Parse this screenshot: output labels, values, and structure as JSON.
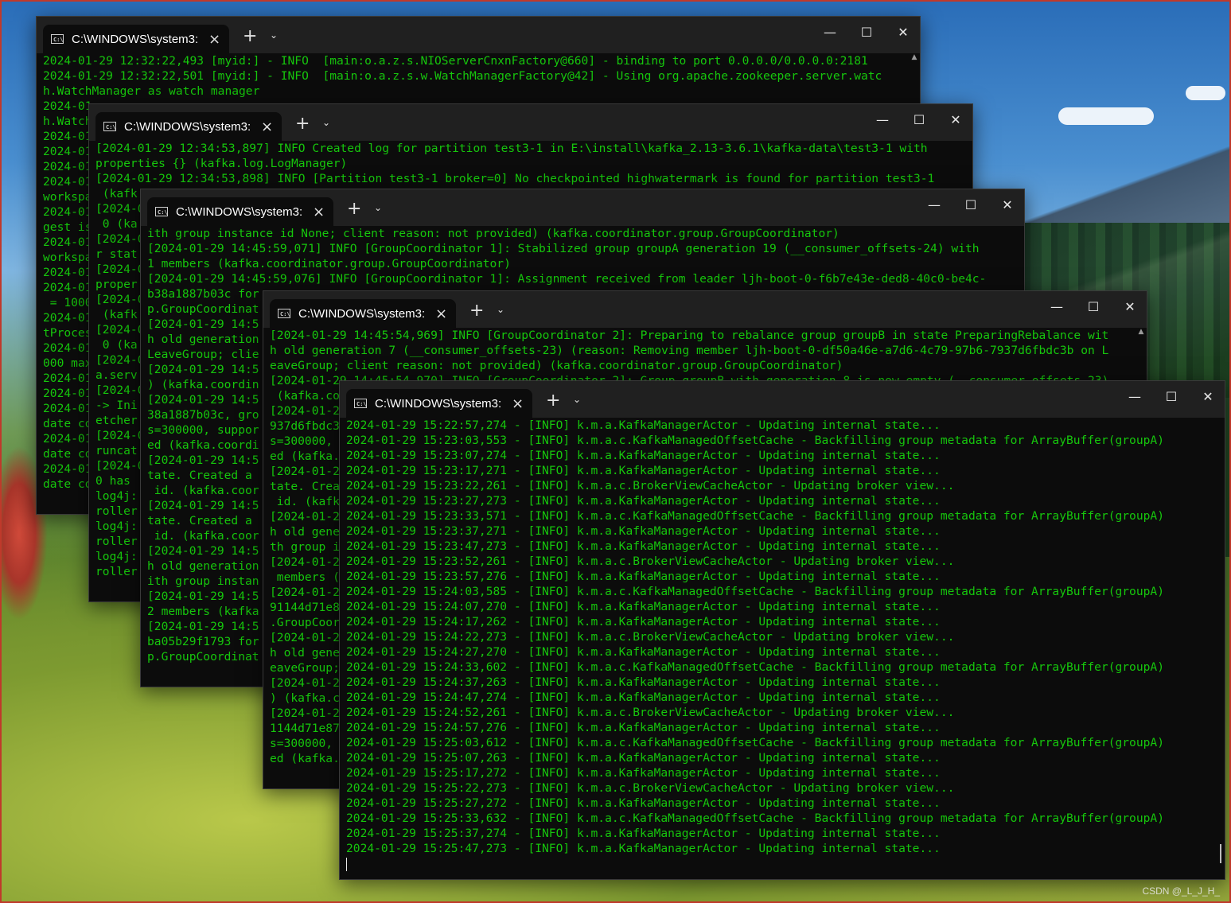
{
  "windows": [
    {
      "title": "C:\\WINDOWS\\system3:",
      "lines": [
        "2024-01-29 12:32:22,493 [myid:] - INFO  [main:o.a.z.s.NIOServerCnxnFactory@660] - binding to port 0.0.0.0/0.0.0.0:2181",
        "2024-01-29 12:32:22,501 [myid:] - INFO  [main:o.a.z.s.w.WatchManagerFactory@42] - Using org.apache.zookeeper.server.watc",
        "h.WatchManager as watch manager",
        "2024-01",
        "h.Watch",
        "2024-01",
        "2024-01",
        "2024-01",
        "2024-01",
        "workspa",
        "2024-01",
        "gest is",
        "2024-01",
        "workspa",
        "2024-01",
        "2024-01",
        " = 1000",
        "2024-01",
        "tProces",
        "2024-01",
        "000 max",
        "2024-01",
        "2024-01",
        "2024-01",
        "date co",
        "2024-01",
        "date co",
        "2024-01",
        "date co"
      ]
    },
    {
      "title": "C:\\WINDOWS\\system3:",
      "lines": [
        "[2024-01-29 12:34:53,897] INFO Created log for partition test3-1 in E:\\install\\kafka_2.13-3.6.1\\kafka-data\\test3-1 with",
        "properties {} (kafka.log.LogManager)",
        "[2024-01-29 12:34:53,898] INFO [Partition test3-1 broker=0] No checkpointed highwatermark is found for partition test3-1",
        " (kafk",
        "[2024-0",
        " 0 (ka",
        "[2024-0",
        "r stat",
        "[2024-0",
        "proper",
        "[2024-0",
        " (kafk",
        "[2024-0",
        " 0 (ka",
        "[2024-0",
        "a.serv",
        "[2024-0",
        "-> Ini",
        "etcher",
        "[2024-0",
        "runcat",
        "[2024-0",
        "0 has",
        "log4j:",
        "roller",
        "log4j:",
        "roller",
        "log4j:",
        "roller"
      ]
    },
    {
      "title": "C:\\WINDOWS\\system3:",
      "lines": [
        "ith group instance id None; client reason: not provided) (kafka.coordinator.group.GroupCoordinator)",
        "[2024-01-29 14:45:59,071] INFO [GroupCoordinator 1]: Stabilized group groupA generation 19 (__consumer_offsets-24) with",
        "1 members (kafka.coordinator.group.GroupCoordinator)",
        "[2024-01-29 14:45:59,076] INFO [GroupCoordinator 1]: Assignment received from leader ljh-boot-0-f6b7e43e-ded8-40c0-be4c-",
        "b38a1887b03c for",
        "p.GroupCoordinat",
        "[2024-01-29 14:5",
        "h old generation",
        "LeaveGroup; clie",
        "[2024-01-29 14:5",
        ") (kafka.coordin",
        "[2024-01-29 14:5",
        "38a1887b03c, gro",
        "s=300000, suppor",
        "ed (kafka.coordi",
        "[2024-01-29 14:5",
        "tate. Created a",
        " id. (kafka.coor",
        "[2024-01-29 14:5",
        "tate. Created a",
        " id. (kafka.coor",
        "[2024-01-29 14:5",
        "h old generation",
        "ith group instan",
        "[2024-01-29 14:5",
        "2 members (kafka",
        "[2024-01-29 14:5",
        "ba05b29f1793 for",
        "p.GroupCoordinat"
      ]
    },
    {
      "title": "C:\\WINDOWS\\system3:",
      "lines": [
        "[2024-01-29 14:45:54,969] INFO [GroupCoordinator 2]: Preparing to rebalance group groupB in state PreparingRebalance wit",
        "h old generation 7 (__consumer_offsets-23) (reason: Removing member ljh-boot-0-df50a46e-a7d6-4c79-97b6-7937d6fbdc3b on L",
        "eaveGroup; client reason: not provided) (kafka.coordinator.group.GroupCoordinator)",
        "[2024-01-29 14:45:54,970] INFO [GroupCoordinator 2]: Group groupB with generation 8 is now empty (__consumer_offsets-23)",
        " (kafka.co",
        "[2024-01-2",
        "937d6fbdc3",
        "s=300000,",
        "ed (kafka.",
        "[2024-01-2",
        "tate. Crea",
        " id. (kafk",
        "[2024-01-2",
        "h old gene",
        "th group i",
        "[2024-01-2",
        " members (",
        "[2024-01-2",
        "91144d71e8",
        ".GroupCoor",
        "[2024-01-2",
        "h old gene",
        "eaveGroup;",
        "[2024-01-2",
        ") (kafka.c",
        "[2024-01-2",
        "1144d71e87",
        "s=300000,",
        "ed (kafka."
      ]
    },
    {
      "title": "C:\\WINDOWS\\system3:",
      "lines": [
        "2024-01-29 15:22:57,274 - [INFO] k.m.a.KafkaManagerActor - Updating internal state...",
        "2024-01-29 15:23:03,553 - [INFO] k.m.a.c.KafkaManagedOffsetCache - Backfilling group metadata for ArrayBuffer(groupA)",
        "2024-01-29 15:23:07,274 - [INFO] k.m.a.KafkaManagerActor - Updating internal state...",
        "2024-01-29 15:23:17,271 - [INFO] k.m.a.KafkaManagerActor - Updating internal state...",
        "2024-01-29 15:23:22,261 - [INFO] k.m.a.c.BrokerViewCacheActor - Updating broker view...",
        "2024-01-29 15:23:27,273 - [INFO] k.m.a.KafkaManagerActor - Updating internal state...",
        "2024-01-29 15:23:33,571 - [INFO] k.m.a.c.KafkaManagedOffsetCache - Backfilling group metadata for ArrayBuffer(groupA)",
        "2024-01-29 15:23:37,271 - [INFO] k.m.a.KafkaManagerActor - Updating internal state...",
        "2024-01-29 15:23:47,273 - [INFO] k.m.a.KafkaManagerActor - Updating internal state...",
        "2024-01-29 15:23:52,261 - [INFO] k.m.a.c.BrokerViewCacheActor - Updating broker view...",
        "2024-01-29 15:23:57,276 - [INFO] k.m.a.KafkaManagerActor - Updating internal state...",
        "2024-01-29 15:24:03,585 - [INFO] k.m.a.c.KafkaManagedOffsetCache - Backfilling group metadata for ArrayBuffer(groupA)",
        "2024-01-29 15:24:07,270 - [INFO] k.m.a.KafkaManagerActor - Updating internal state...",
        "2024-01-29 15:24:17,262 - [INFO] k.m.a.KafkaManagerActor - Updating internal state...",
        "2024-01-29 15:24:22,273 - [INFO] k.m.a.c.BrokerViewCacheActor - Updating broker view...",
        "2024-01-29 15:24:27,270 - [INFO] k.m.a.KafkaManagerActor - Updating internal state...",
        "2024-01-29 15:24:33,602 - [INFO] k.m.a.c.KafkaManagedOffsetCache - Backfilling group metadata for ArrayBuffer(groupA)",
        "2024-01-29 15:24:37,263 - [INFO] k.m.a.KafkaManagerActor - Updating internal state...",
        "2024-01-29 15:24:47,274 - [INFO] k.m.a.KafkaManagerActor - Updating internal state...",
        "2024-01-29 15:24:52,261 - [INFO] k.m.a.c.BrokerViewCacheActor - Updating broker view...",
        "2024-01-29 15:24:57,276 - [INFO] k.m.a.KafkaManagerActor - Updating internal state...",
        "2024-01-29 15:25:03,612 - [INFO] k.m.a.c.KafkaManagedOffsetCache - Backfilling group metadata for ArrayBuffer(groupA)",
        "2024-01-29 15:25:07,263 - [INFO] k.m.a.KafkaManagerActor - Updating internal state...",
        "2024-01-29 15:25:17,272 - [INFO] k.m.a.KafkaManagerActor - Updating internal state...",
        "2024-01-29 15:25:22,273 - [INFO] k.m.a.c.BrokerViewCacheActor - Updating broker view...",
        "2024-01-29 15:25:27,272 - [INFO] k.m.a.KafkaManagerActor - Updating internal state...",
        "2024-01-29 15:25:33,632 - [INFO] k.m.a.c.KafkaManagedOffsetCache - Backfilling group metadata for ArrayBuffer(groupA)",
        "2024-01-29 15:25:37,274 - [INFO] k.m.a.KafkaManagerActor - Updating internal state...",
        "2024-01-29 15:25:47,273 - [INFO] k.m.a.KafkaManagerActor - Updating internal state..."
      ]
    }
  ],
  "icons": {
    "tab_icon": "terminal-icon",
    "close_tab": "×",
    "new_tab": "+",
    "dropdown": "⌄",
    "minimize": "—",
    "maximize": "☐",
    "close": "✕",
    "scroll_up": "▲"
  },
  "colors": {
    "terminal_text": "#16c60c",
    "terminal_bg": "#0c0c0c",
    "titlebar_bg": "#202020"
  },
  "watermark": "CSDN @_L_J_H_"
}
